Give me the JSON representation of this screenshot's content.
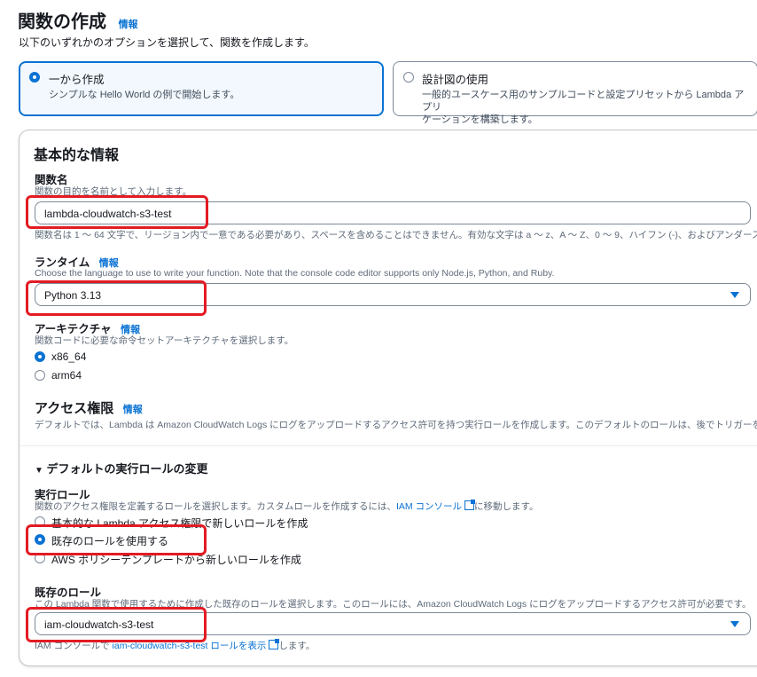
{
  "header": {
    "title": "関数の作成",
    "info": "情報",
    "subtitle": "以下のいずれかのオプションを選択して、関数を作成します。"
  },
  "options": {
    "scratch": {
      "title": "一から作成",
      "desc": "シンプルな Hello World の例で開始します。",
      "selected": true
    },
    "blueprint": {
      "title": "設計図の使用",
      "desc_line1": "一般的ユースケース用のサンプルコードと設定プリセットから Lambda アプリ",
      "desc_line2": "ケーションを構築します。",
      "selected": false
    }
  },
  "basic": {
    "title": "基本的な情報",
    "function_name": {
      "label": "関数名",
      "desc": "関数の目的を名前として入力します。",
      "value": "lambda-cloudwatch-s3-test",
      "constraint": "関数名は 1 ～ 64 文字で、リージョン内で一意である必要があり、スペースを含めることはできません。有効な文字は a ～ z、A ～ Z、0 ～ 9、ハイフン (-)、およびアンダースコ"
    },
    "runtime": {
      "label": "ランタイム",
      "info": "情報",
      "desc": "Choose the language to use to write your function. Note that the console code editor supports only Node.js, Python, and Ruby.",
      "value": "Python 3.13"
    },
    "architecture": {
      "label": "アーキテクチャ",
      "info": "情報",
      "desc": "関数コードに必要な命令セットアーキテクチャを選択します。",
      "options": [
        "x86_64",
        "arm64"
      ],
      "selected": "x86_64"
    },
    "permissions": {
      "title": "アクセス権限",
      "info": "情報",
      "desc": "デフォルトでは、Lambda は Amazon CloudWatch Logs にログをアップロードするアクセス許可を持つ実行ロールを作成します。このデフォルトのロールは、後でトリガーを追"
    }
  },
  "role": {
    "expander": "デフォルトの実行ロールの変更",
    "exec_label": "実行ロール",
    "exec_desc_pre": "関数のアクセス権限を定義するロールを選択します。カスタムロールを作成するには、",
    "exec_desc_link": "IAM コンソール",
    "exec_desc_post": "に移動します。",
    "options": [
      "基本的な Lambda アクセス権限で新しいロールを作成",
      "既存のロールを使用する",
      "AWS ポリシーテンプレートから新しいロールを作成"
    ],
    "selected": "既存のロールを使用する",
    "existing_label": "既存のロール",
    "existing_desc": "この Lambda 関数で使用するために作成した既存のロールを選択します。このロールには、Amazon CloudWatch Logs にログをアップロードするアクセス許可が必要です。",
    "existing_value": "iam-cloudwatch-s3-test",
    "footer_pre": "IAM コンソールで ",
    "footer_link": "iam-cloudwatch-s3-test ロールを表示",
    "footer_post": "します。"
  },
  "colors": {
    "accent": "#0972d3",
    "highlight": "#e31b23"
  }
}
